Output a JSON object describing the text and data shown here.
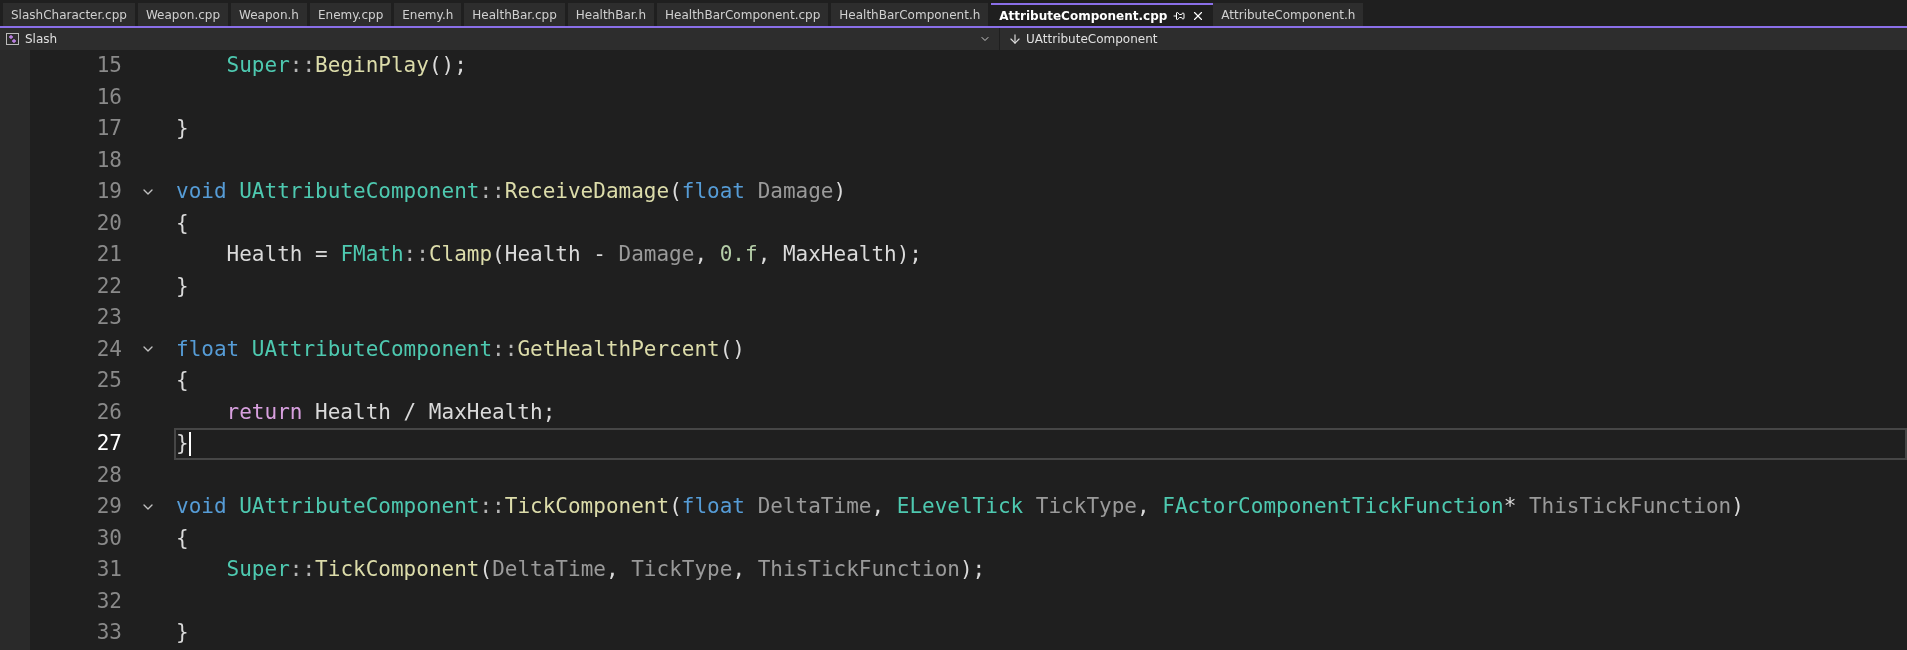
{
  "tabs": [
    {
      "label": "SlashCharacter.cpp",
      "selected": false
    },
    {
      "label": "Weapon.cpp",
      "selected": false
    },
    {
      "label": "Weapon.h",
      "selected": false
    },
    {
      "label": "Enemy.cpp",
      "selected": false
    },
    {
      "label": "Enemy.h",
      "selected": false
    },
    {
      "label": "HealthBar.cpp",
      "selected": false
    },
    {
      "label": "HealthBar.h",
      "selected": false
    },
    {
      "label": "HealthBarComponent.cpp",
      "selected": false
    },
    {
      "label": "HealthBarComponent.h",
      "selected": false
    },
    {
      "label": "AttributeComponent.cpp",
      "selected": true
    },
    {
      "label": "AttributeComponent.h",
      "selected": false
    }
  ],
  "navigation_bar": {
    "project": "Slash",
    "member": "UAttributeComponent"
  },
  "editor": {
    "lines": [
      {
        "number": "15",
        "fold": false,
        "current": false,
        "tokens": [
          {
            "kind": "type",
            "text": "    Super"
          },
          {
            "kind": "punct",
            "text": "::"
          },
          {
            "kind": "fn",
            "text": "BeginPlay"
          },
          {
            "kind": "plain",
            "text": "();"
          }
        ]
      },
      {
        "number": "16",
        "fold": false,
        "current": false
      },
      {
        "number": "17",
        "fold": false,
        "current": false,
        "tokens": [
          {
            "kind": "plain",
            "text": "}"
          }
        ]
      },
      {
        "number": "18",
        "fold": false,
        "current": false
      },
      {
        "number": "19",
        "fold": true,
        "current": false,
        "tokens": [
          {
            "kind": "kw",
            "text": "void"
          },
          {
            "kind": "type",
            "text": " UAttributeComponent"
          },
          {
            "kind": "punct",
            "text": "::"
          },
          {
            "kind": "fn",
            "text": "ReceiveDamage"
          },
          {
            "kind": "plain",
            "text": "("
          },
          {
            "kind": "kw",
            "text": "float"
          },
          {
            "kind": "param",
            "text": " Damage"
          },
          {
            "kind": "plain",
            "text": ")"
          }
        ]
      },
      {
        "number": "20",
        "fold": false,
        "current": false,
        "tokens": [
          {
            "kind": "plain",
            "text": "{"
          }
        ]
      },
      {
        "number": "21",
        "fold": false,
        "current": false,
        "tokens": [
          {
            "kind": "plain",
            "text": "    Health = "
          },
          {
            "kind": "type",
            "text": "FMath"
          },
          {
            "kind": "punct",
            "text": "::"
          },
          {
            "kind": "fn",
            "text": "Clamp"
          },
          {
            "kind": "plain",
            "text": "(Health - "
          },
          {
            "kind": "param",
            "text": "Damage"
          },
          {
            "kind": "plain",
            "text": ", "
          },
          {
            "kind": "num",
            "text": "0.f"
          },
          {
            "kind": "plain",
            "text": ", MaxHealth);"
          }
        ]
      },
      {
        "number": "22",
        "fold": false,
        "current": false,
        "tokens": [
          {
            "kind": "plain",
            "text": "}"
          }
        ]
      },
      {
        "number": "23",
        "fold": false,
        "current": false
      },
      {
        "number": "24",
        "fold": true,
        "current": false,
        "tokens": [
          {
            "kind": "kw",
            "text": "float"
          },
          {
            "kind": "type",
            "text": " UAttributeComponent"
          },
          {
            "kind": "punct",
            "text": "::"
          },
          {
            "kind": "fn",
            "text": "GetHealthPercent"
          },
          {
            "kind": "plain",
            "text": "()"
          }
        ]
      },
      {
        "number": "25",
        "fold": false,
        "current": false,
        "tokens": [
          {
            "kind": "plain",
            "text": "{"
          }
        ]
      },
      {
        "number": "26",
        "fold": false,
        "current": false,
        "tokens": [
          {
            "kind": "ctl",
            "text": "    return"
          },
          {
            "kind": "plain",
            "text": " Health / MaxHealth;"
          }
        ]
      },
      {
        "number": "27",
        "fold": false,
        "current": true,
        "tokens": [
          {
            "kind": "plain",
            "text": "}"
          }
        ]
      },
      {
        "number": "28",
        "fold": false,
        "current": false
      },
      {
        "number": "29",
        "fold": true,
        "current": false,
        "tokens": [
          {
            "kind": "kw",
            "text": "void"
          },
          {
            "kind": "type",
            "text": " UAttributeComponent"
          },
          {
            "kind": "punct",
            "text": "::"
          },
          {
            "kind": "fn",
            "text": "TickComponent"
          },
          {
            "kind": "plain",
            "text": "("
          },
          {
            "kind": "kw",
            "text": "float"
          },
          {
            "kind": "param",
            "text": " DeltaTime"
          },
          {
            "kind": "plain",
            "text": ", "
          },
          {
            "kind": "type",
            "text": "ELevelTick"
          },
          {
            "kind": "param",
            "text": " TickType"
          },
          {
            "kind": "plain",
            "text": ", "
          },
          {
            "kind": "type",
            "text": "FActorComponentTickFunction"
          },
          {
            "kind": "plain",
            "text": "*"
          },
          {
            "kind": "param",
            "text": " ThisTickFunction"
          },
          {
            "kind": "plain",
            "text": ")"
          }
        ]
      },
      {
        "number": "30",
        "fold": false,
        "current": false,
        "tokens": [
          {
            "kind": "plain",
            "text": "{"
          }
        ]
      },
      {
        "number": "31",
        "fold": false,
        "current": false,
        "tokens": [
          {
            "kind": "type",
            "text": "    Super"
          },
          {
            "kind": "punct",
            "text": "::"
          },
          {
            "kind": "fn",
            "text": "TickComponent"
          },
          {
            "kind": "plain",
            "text": "("
          },
          {
            "kind": "param",
            "text": "DeltaTime"
          },
          {
            "kind": "plain",
            "text": ", "
          },
          {
            "kind": "param",
            "text": "TickType"
          },
          {
            "kind": "plain",
            "text": ", "
          },
          {
            "kind": "param",
            "text": "ThisTickFunction"
          },
          {
            "kind": "plain",
            "text": ");"
          }
        ]
      },
      {
        "number": "32",
        "fold": false,
        "current": false
      },
      {
        "number": "33",
        "fold": false,
        "current": false,
        "tokens": [
          {
            "kind": "plain",
            "text": "}"
          }
        ]
      }
    ]
  }
}
